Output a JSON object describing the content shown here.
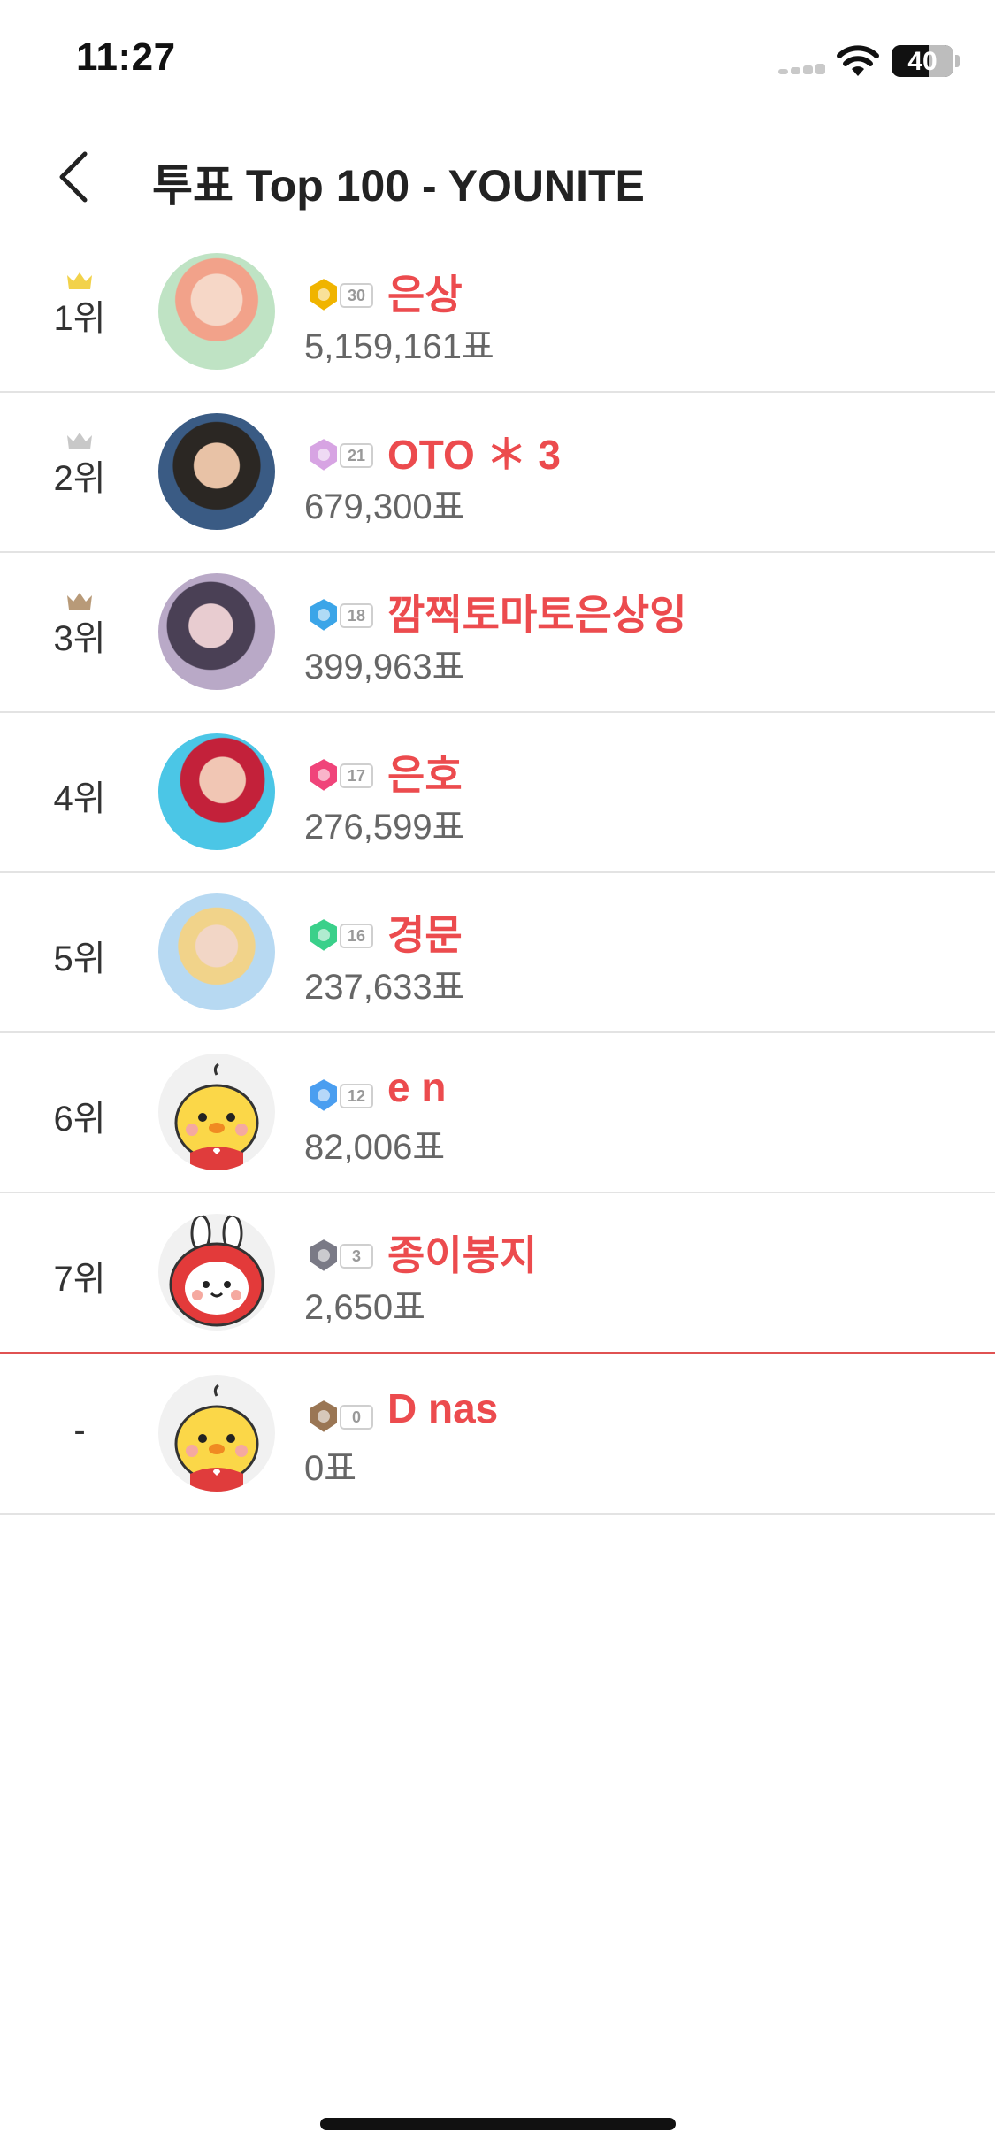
{
  "status_bar": {
    "time": "11:27",
    "battery": "40"
  },
  "header": {
    "title": "투표 Top 100 - YOUNITE",
    "back_icon": "chevron-left-icon"
  },
  "colors": {
    "accent": "#ec4b4e",
    "gold": "#f2d24a",
    "silver": "#c8c8c8",
    "bronze": "#b89a78",
    "divider": "#e3e3e3"
  },
  "rows": [
    {
      "rank": "1위",
      "crown": "gold",
      "level": "30",
      "name": "은상",
      "votes": "5,159,161표",
      "avatar": "photo"
    },
    {
      "rank": "2위",
      "crown": "silver",
      "level": "21",
      "name": "OTO ＊ 3",
      "votes": "679,300표",
      "avatar": "photo"
    },
    {
      "rank": "3위",
      "crown": "bronze",
      "level": "18",
      "name": "깜찍토마토은상잉",
      "votes": "399,963표",
      "avatar": "photo"
    },
    {
      "rank": "4위",
      "crown": "",
      "level": "17",
      "name": "은호",
      "votes": "276,599표",
      "avatar": "photo"
    },
    {
      "rank": "5위",
      "crown": "",
      "level": "16",
      "name": "경문",
      "votes": "237,633표",
      "avatar": "photo"
    },
    {
      "rank": "6위",
      "crown": "",
      "level": "12",
      "name": "e n",
      "votes": "82,006표",
      "avatar": "chick"
    },
    {
      "rank": "7위",
      "crown": "",
      "level": "3",
      "name": "종이봉지",
      "votes": "2,650표",
      "avatar": "bunny"
    },
    {
      "rank": "-",
      "crown": "",
      "level": "0",
      "name": "D nas",
      "votes": "0표",
      "avatar": "chick"
    }
  ]
}
